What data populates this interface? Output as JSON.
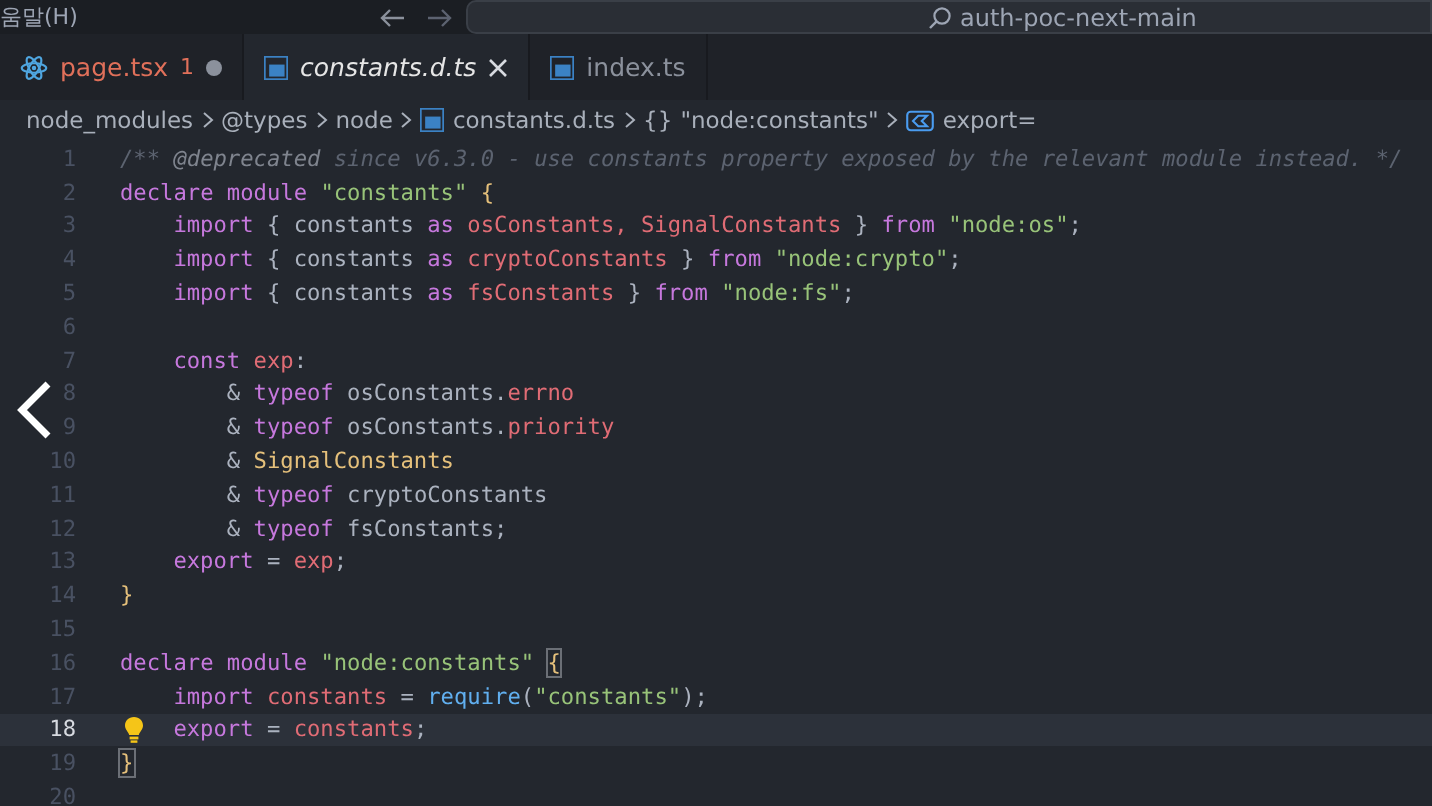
{
  "titlebar": {
    "menu": "움말(H)",
    "search": "auth-poc-next-main"
  },
  "tabs": [
    {
      "label": "page.tsx",
      "kind": "react",
      "problems": "1",
      "dirty": true,
      "error": true,
      "preview": false,
      "selected": false
    },
    {
      "label": "constants.d.ts",
      "kind": "ts",
      "dirty": false,
      "error": false,
      "preview": true,
      "selected": true
    },
    {
      "label": "index.ts",
      "kind": "ts",
      "dirty": false,
      "error": false,
      "preview": false,
      "selected": false
    }
  ],
  "breadcrumbs": [
    {
      "label": "node_modules"
    },
    {
      "label": "@types"
    },
    {
      "label": "node"
    },
    {
      "label": "constants.d.ts",
      "kind": "ts"
    },
    {
      "label": "\"node:constants\"",
      "symbol": "{}"
    },
    {
      "label": "export=",
      "kind": "variable"
    }
  ],
  "lines": [
    {
      "number": "1",
      "current": false,
      "tokens": [
        {
          "kind": "comment",
          "text": "/** "
        },
        {
          "kind": "tag",
          "text": "@deprecated"
        },
        {
          "kind": "comment",
          "text": " since v6.3.0 - use constants property exposed by the relevant module instead. */"
        }
      ]
    },
    {
      "number": "2",
      "current": false,
      "tokens": [
        {
          "kind": "kw",
          "text": "declare module "
        },
        {
          "kind": "str",
          "text": "\"constants\" "
        },
        {
          "kind": "brace",
          "text": "{"
        }
      ]
    },
    {
      "number": "3",
      "current": false,
      "tokens": [
        {
          "kind": "kw",
          "text": "    import "
        },
        {
          "kind": "plain",
          "text": "{ constants "
        },
        {
          "kind": "kw",
          "text": "as "
        },
        {
          "kind": "var",
          "text": "osConstants, SignalConstants "
        },
        {
          "kind": "plain",
          "text": "} "
        },
        {
          "kind": "kw",
          "text": "from "
        },
        {
          "kind": "str",
          "text": "\"node:os\""
        },
        {
          "kind": "plain",
          "text": ";"
        }
      ]
    },
    {
      "number": "4",
      "current": false,
      "tokens": [
        {
          "kind": "kw",
          "text": "    import "
        },
        {
          "kind": "plain",
          "text": "{ constants "
        },
        {
          "kind": "kw",
          "text": "as "
        },
        {
          "kind": "var",
          "text": "cryptoConstants "
        },
        {
          "kind": "plain",
          "text": "} "
        },
        {
          "kind": "kw",
          "text": "from "
        },
        {
          "kind": "str",
          "text": "\"node:crypto\""
        },
        {
          "kind": "plain",
          "text": ";"
        }
      ]
    },
    {
      "number": "5",
      "current": false,
      "tokens": [
        {
          "kind": "kw",
          "text": "    import "
        },
        {
          "kind": "plain",
          "text": "{ constants "
        },
        {
          "kind": "kw",
          "text": "as "
        },
        {
          "kind": "var",
          "text": "fsConstants "
        },
        {
          "kind": "plain",
          "text": "} "
        },
        {
          "kind": "kw",
          "text": "from "
        },
        {
          "kind": "str",
          "text": "\"node:fs\""
        },
        {
          "kind": "plain",
          "text": ";"
        }
      ]
    },
    {
      "number": "6",
      "current": false
    },
    {
      "number": "7",
      "current": false,
      "tokens": [
        {
          "kind": "kw",
          "text": "    const "
        },
        {
          "kind": "var",
          "text": "exp"
        },
        {
          "kind": "plain",
          "text": ":"
        }
      ]
    },
    {
      "number": "8",
      "current": false,
      "tokens": [
        {
          "kind": "plain",
          "text": "        & "
        },
        {
          "kind": "kw",
          "text": "typeof "
        },
        {
          "kind": "plain",
          "text": "osConstants."
        },
        {
          "kind": "var",
          "text": "errno"
        }
      ]
    },
    {
      "number": "9",
      "current": false,
      "tokens": [
        {
          "kind": "plain",
          "text": "        & "
        },
        {
          "kind": "kw",
          "text": "typeof "
        },
        {
          "kind": "plain",
          "text": "osConstants."
        },
        {
          "kind": "var",
          "text": "priority"
        }
      ]
    },
    {
      "number": "10",
      "current": false,
      "tokens": [
        {
          "kind": "plain",
          "text": "        & "
        },
        {
          "kind": "type",
          "text": "SignalConstants"
        }
      ]
    },
    {
      "number": "11",
      "current": false,
      "tokens": [
        {
          "kind": "plain",
          "text": "        & "
        },
        {
          "kind": "kw",
          "text": "typeof "
        },
        {
          "kind": "plain",
          "text": "cryptoConstants"
        }
      ]
    },
    {
      "number": "12",
      "current": false,
      "tokens": [
        {
          "kind": "plain",
          "text": "        & "
        },
        {
          "kind": "kw",
          "text": "typeof "
        },
        {
          "kind": "plain",
          "text": "fsConstants;"
        }
      ]
    },
    {
      "number": "13",
      "current": false,
      "tokens": [
        {
          "kind": "kw",
          "text": "    export "
        },
        {
          "kind": "plain",
          "text": "= "
        },
        {
          "kind": "var",
          "text": "exp"
        },
        {
          "kind": "plain",
          "text": ";"
        }
      ]
    },
    {
      "number": "14",
      "current": false,
      "tokens": [
        {
          "kind": "brace",
          "text": "}"
        }
      ]
    },
    {
      "number": "15",
      "current": false
    },
    {
      "number": "16",
      "current": false,
      "tokens": [
        {
          "kind": "kw",
          "text": "declare module "
        },
        {
          "kind": "str",
          "text": "\"node:constants\" "
        },
        {
          "kind": "matched-brace",
          "text": "{"
        }
      ]
    },
    {
      "number": "17",
      "current": false,
      "tokens": [
        {
          "kind": "kw",
          "text": "    import "
        },
        {
          "kind": "var",
          "text": "constants "
        },
        {
          "kind": "plain",
          "text": "= "
        },
        {
          "kind": "fn",
          "text": "require"
        },
        {
          "kind": "plain",
          "text": "("
        },
        {
          "kind": "str",
          "text": "\"constants\""
        },
        {
          "kind": "plain",
          "text": ");"
        }
      ]
    },
    {
      "number": "18",
      "current": true,
      "lightbulb": true,
      "tokens": [
        {
          "kind": "kw",
          "text": "    export "
        },
        {
          "kind": "plain",
          "text": "= "
        },
        {
          "kind": "var",
          "text": "constants"
        },
        {
          "kind": "plain",
          "text": ";"
        }
      ]
    },
    {
      "number": "19",
      "current": false,
      "tokens": [
        {
          "kind": "matched-brace",
          "text": "}"
        }
      ]
    },
    {
      "number": "20",
      "current": false
    }
  ]
}
